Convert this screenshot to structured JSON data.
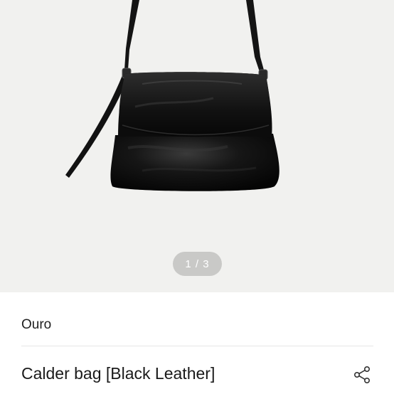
{
  "gallery": {
    "image_alt": "Calder bag black leather shoulder bag",
    "pager_text": "1 / 3",
    "current_index": 1,
    "total": 3
  },
  "product": {
    "brand": "Ouro",
    "title": "Calder bag [Black Leather]"
  },
  "icons": {
    "share": "share-icon"
  },
  "colors": {
    "gallery_bg": "#f1f1ef",
    "pager_bg": "#c9c9c7",
    "text": "#1a1a1a",
    "divider": "#e6e6e6"
  }
}
